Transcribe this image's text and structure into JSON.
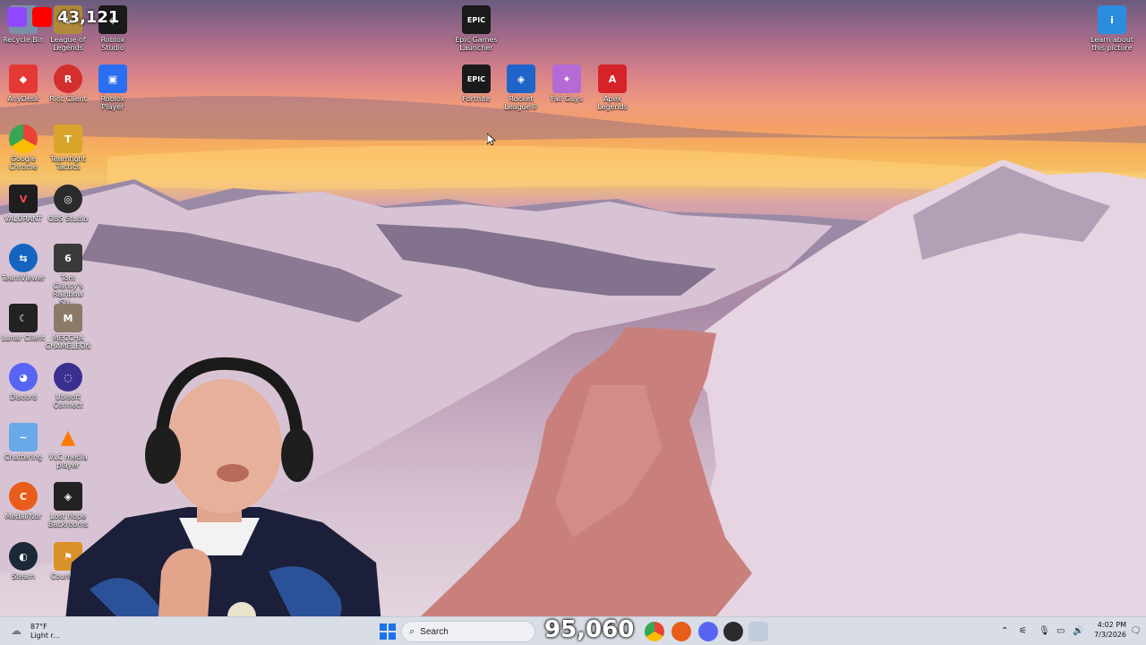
{
  "desktop": {
    "icons": [
      {
        "name": "recycle-bin",
        "label": "Recycle Bin",
        "glyph": "♻",
        "color": "#7b8fa8"
      },
      {
        "name": "league-of-legends",
        "label": "League of Legends",
        "glyph": "L",
        "color": "#b08a3a"
      },
      {
        "name": "roblox-studio",
        "label": "Roblox Studio",
        "glyph": "◆",
        "color": "#1a1a1a"
      },
      {
        "name": "anydesk",
        "label": "AnyDesk",
        "glyph": "◆",
        "color": "#e53935"
      },
      {
        "name": "riot-client",
        "label": "Riot Client",
        "glyph": "R",
        "color": "#d32f2f"
      },
      {
        "name": "roblox-player",
        "label": "Roblox Player",
        "glyph": "▣",
        "color": "#2b6ef2"
      },
      {
        "name": "google-chrome",
        "label": "Google Chrome",
        "glyph": "◉",
        "color": "#34a853"
      },
      {
        "name": "teamfight-tactics",
        "label": "Teamfight Tactics",
        "glyph": "T",
        "color": "#d9a52a"
      },
      {
        "name": "valorant",
        "label": "VALORANT",
        "glyph": "V",
        "color": "#b0243a"
      },
      {
        "name": "obs-studio",
        "label": "OBS Studio",
        "glyph": "◎",
        "color": "#2b2b2b"
      },
      {
        "name": "teamviewer",
        "label": "TeamViewer",
        "glyph": "⇆",
        "color": "#1565c0"
      },
      {
        "name": "rainbow-six",
        "label": "Tom Clancy's Rainbow Six...",
        "glyph": "6",
        "color": "#3a3a3a"
      },
      {
        "name": "lunar-client",
        "label": "Lunar Client",
        "glyph": "☾",
        "color": "#222"
      },
      {
        "name": "meccha-chameleon",
        "label": "MECCHA CHAMELEON",
        "glyph": "M",
        "color": "#8a7a68"
      },
      {
        "name": "discord",
        "label": "Discord",
        "glyph": "◕",
        "color": "#5865f2"
      },
      {
        "name": "ubisoft-connect",
        "label": "Ubisoft Connect",
        "glyph": "◌",
        "color": "#3a2f8f"
      },
      {
        "name": "chattering",
        "label": "Chattering",
        "glyph": "~",
        "color": "#6aa9e8"
      },
      {
        "name": "vlc-media-player",
        "label": "VLC media player",
        "glyph": "▲",
        "color": "#ff7a00"
      },
      {
        "name": "medal",
        "label": "Medal/Nor",
        "glyph": "C",
        "color": "#e85d1c"
      },
      {
        "name": "lost-hope",
        "label": "Lost Hope Backrooms",
        "glyph": "◈",
        "color": "#222"
      },
      {
        "name": "steam",
        "label": "Steam",
        "glyph": "◐",
        "color": "#1b2838"
      },
      {
        "name": "counter-strike",
        "label": "Counter...",
        "glyph": "⚑",
        "color": "#d9922a"
      },
      {
        "name": "epic-games-launcher",
        "label": "Epic Games Launcher",
        "glyph": "EPIC",
        "color": "#1a1a1a"
      },
      {
        "name": "fortnite",
        "label": "Fortnite",
        "glyph": "EPIC",
        "color": "#1a1a1a"
      },
      {
        "name": "rocket-league",
        "label": "Rocket League®",
        "glyph": "◈",
        "color": "#1f64c8"
      },
      {
        "name": "fall-guys",
        "label": "Fall Guys",
        "glyph": "✦",
        "color": "#b46bd6"
      },
      {
        "name": "apex-legends",
        "label": "Apex Legends",
        "glyph": "A",
        "color": "#d6232a"
      },
      {
        "name": "learn-about-picture",
        "label": "Learn about this picture",
        "glyph": "i",
        "color": "#2a8de0"
      }
    ]
  },
  "overlay": {
    "top_counter": "43,121",
    "bottom_counter": "95,060"
  },
  "taskbar": {
    "weather_temp": "87°F",
    "weather_desc": "Light r...",
    "search_placeholder": "Search",
    "clock_time": "4:02 PM",
    "clock_date": "7/3/2026"
  }
}
